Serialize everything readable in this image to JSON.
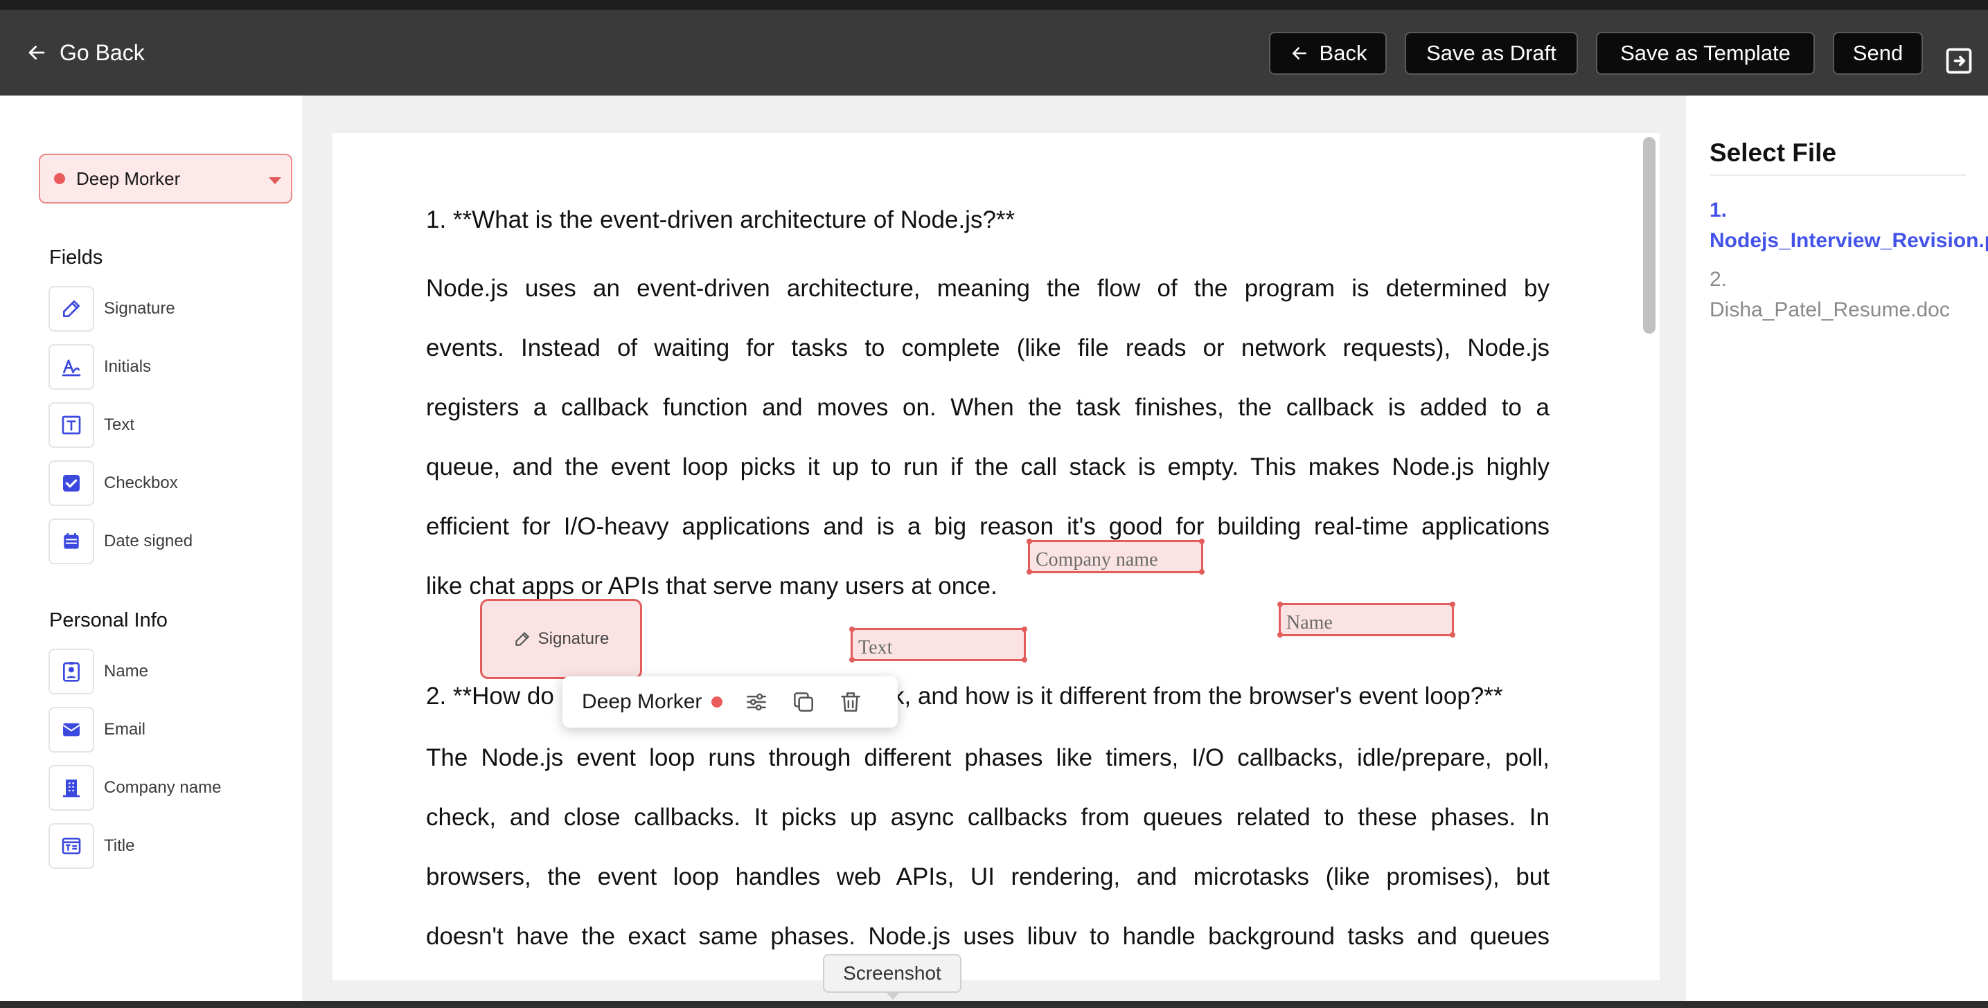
{
  "topbar": {
    "go_back_label": "Go Back",
    "back_label": "Back",
    "save_draft_label": "Save as Draft",
    "save_template_label": "Save as Template",
    "send_label": "Send"
  },
  "sidebar": {
    "signer": {
      "name": "Deep Morker",
      "color": "#ea5b5b"
    },
    "fields_title": "Fields",
    "fields": [
      {
        "label": "Signature",
        "icon": "pen-icon"
      },
      {
        "label": "Initials",
        "icon": "initials-icon"
      },
      {
        "label": "Text",
        "icon": "text-icon"
      },
      {
        "label": "Checkbox",
        "icon": "checkbox-icon"
      },
      {
        "label": "Date signed",
        "icon": "calendar-icon"
      }
    ],
    "personal_title": "Personal Info",
    "personal": [
      {
        "label": "Name",
        "icon": "id-badge-icon"
      },
      {
        "label": "Email",
        "icon": "envelope-icon"
      },
      {
        "label": "Company name",
        "icon": "building-icon"
      },
      {
        "label": "Title",
        "icon": "title-card-icon"
      }
    ]
  },
  "document": {
    "q1_heading": "1. **What is the event-driven architecture of Node.js?**",
    "q1_lines": [
      "Node.js uses an event-driven architecture, meaning the flow of the program is determined by",
      "events. Instead of waiting for tasks to complete (like file reads or network requests), Node.js",
      "registers a callback function and moves on. When the task finishes, the callback is added to a",
      "queue, and the event loop picks it up to run if the call stack is empty. This makes Node.js highly",
      "efficient for I/O-heavy applications and is a big reason it's good for building real-time applications",
      "like chat apps or APIs that serve many users at once."
    ],
    "q2_heading_start": "2. **How do",
    "q2_heading_end": "k, and how is it different from the browser's event loop?**",
    "q2_lines": [
      "The Node.js event loop runs through different phases like timers, I/O callbacks, idle/prepare, poll,",
      "check, and close callbacks. It picks up async callbacks from queues related to these phases. In",
      "browsers, the event loop handles web APIs, UI rendering, and microtasks (like promises), but",
      "doesn't have the exact same phases. Node.js uses libuv to handle background tasks and queues"
    ]
  },
  "placed_fields": {
    "company_name": "Company name",
    "text": "Text",
    "name": "Name",
    "signature": "Signature"
  },
  "field_toolbar": {
    "signer_name": "Deep Morker"
  },
  "tooltip": "Screenshot",
  "files": {
    "title": "Select File",
    "items": [
      {
        "index": "1.",
        "name": "Nodejs_Interview_Revision.p",
        "active": true
      },
      {
        "index": "2.",
        "name": "Disha_Patel_Resume.doc",
        "active": false
      }
    ]
  },
  "colors": {
    "accent": "#4353e8",
    "signer": "#ea5b5b",
    "topbar": "#3a3a3a"
  }
}
